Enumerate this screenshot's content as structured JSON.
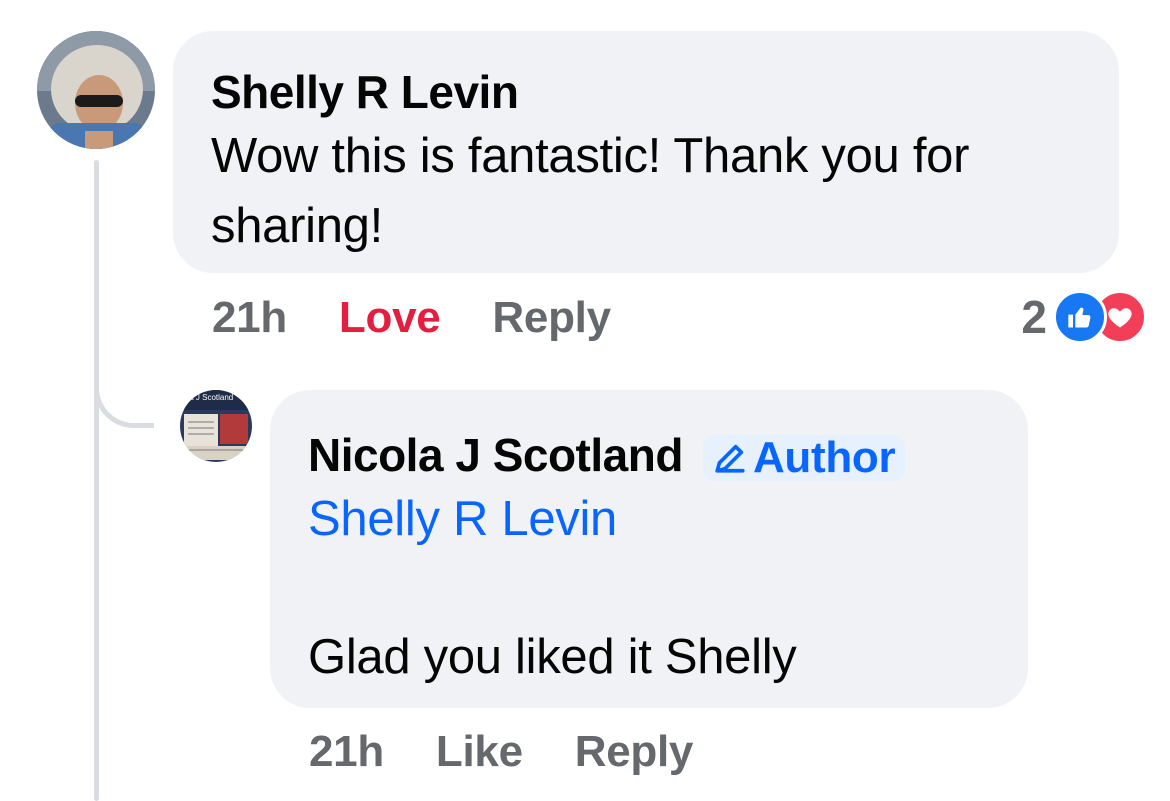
{
  "comment": {
    "author": "Shelly R Levin",
    "text": "Wow this is fantastic! Thank you for sharing!",
    "timestamp": "21h",
    "reaction_label": "Love",
    "reply_label": "Reply",
    "reaction_count": "2",
    "reaction_icons": [
      "like-icon",
      "heart-icon"
    ],
    "reaction_color": "#e41e3f"
  },
  "reply": {
    "author": "Nicola J Scotland",
    "badge": "Author",
    "mention": "Shelly R Levin",
    "text": "Glad you liked it Shelly",
    "timestamp": "21h",
    "like_label": "Like",
    "reply_label": "Reply",
    "avatar_text": "ola J Scotland"
  },
  "colors": {
    "bubble": "#f0f2f5",
    "link_blue": "#0866ff",
    "meta_gray": "#65686c",
    "love_red": "#e41e3f"
  }
}
